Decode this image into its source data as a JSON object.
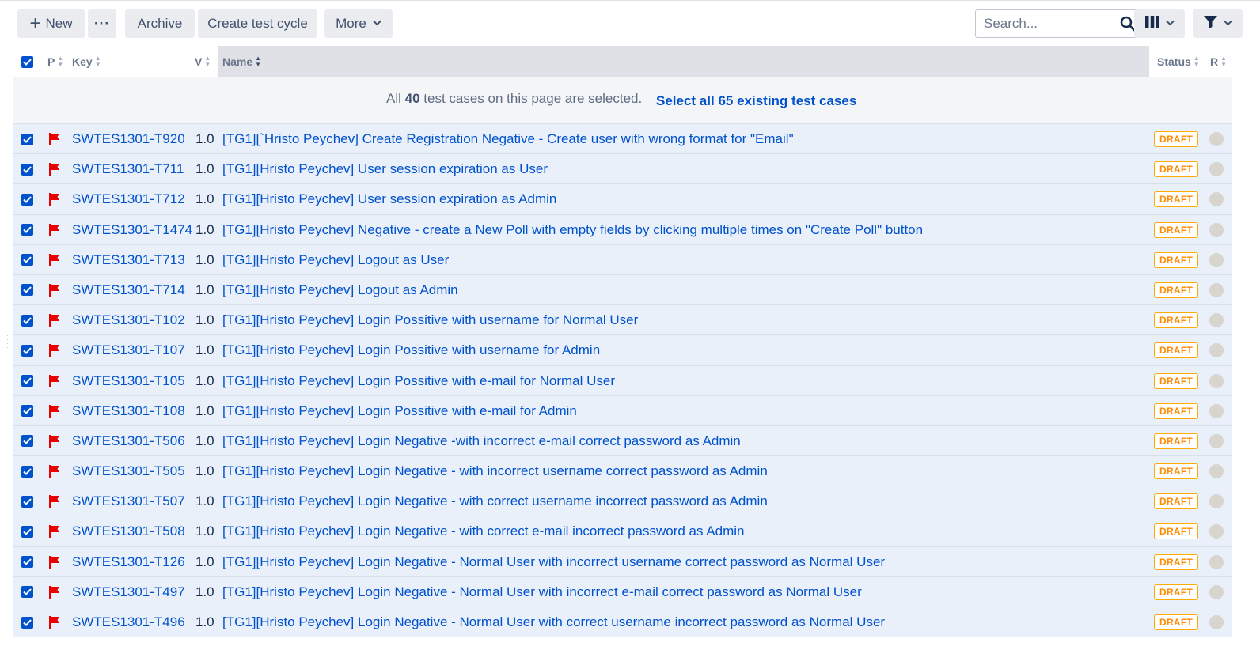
{
  "toolbar": {
    "new_label": "New",
    "more_dots_label": "···",
    "archive_label": "Archive",
    "create_cycle_label": "Create test cycle",
    "more_label": "More",
    "search_placeholder": "Search..."
  },
  "columns": {
    "priority": "P",
    "key": "Key",
    "version": "V",
    "name": "Name",
    "status": "Status",
    "result": "R"
  },
  "selection_banner": {
    "prefix": "All ",
    "count": "40",
    "suffix": " test cases on this page are selected.",
    "link_prefix": "Select all ",
    "link_count": "65",
    "link_suffix": " existing test cases"
  },
  "rows": [
    {
      "key": "SWTES1301-T920",
      "version": "1.0",
      "name": "[TG1][`Hristo Peychev] Create Registration Negative - Create user with wrong format for \"Email\"",
      "status": "DRAFT"
    },
    {
      "key": "SWTES1301-T711",
      "version": "1.0",
      "name": "[TG1][Hristo Peychev] User session expiration as User",
      "status": "DRAFT"
    },
    {
      "key": "SWTES1301-T712",
      "version": "1.0",
      "name": "[TG1][Hristo Peychev] User session expiration as Admin",
      "status": "DRAFT"
    },
    {
      "key": "SWTES1301-T1474",
      "version": "1.0",
      "name": "[TG1][Hristo Peychev] Negative - create a New Poll with empty fields by clicking multiple times on \"Create Poll\" button",
      "status": "DRAFT"
    },
    {
      "key": "SWTES1301-T713",
      "version": "1.0",
      "name": "[TG1][Hristo Peychev] Logout as User",
      "status": "DRAFT"
    },
    {
      "key": "SWTES1301-T714",
      "version": "1.0",
      "name": "[TG1][Hristo Peychev] Logout as Admin",
      "status": "DRAFT"
    },
    {
      "key": "SWTES1301-T102",
      "version": "1.0",
      "name": "[TG1][Hristo Peychev] Login Possitive with username for Normal User",
      "status": "DRAFT"
    },
    {
      "key": "SWTES1301-T107",
      "version": "1.0",
      "name": "[TG1][Hristo Peychev] Login Possitive with username for Admin",
      "status": "DRAFT"
    },
    {
      "key": "SWTES1301-T105",
      "version": "1.0",
      "name": "[TG1][Hristo Peychev] Login Possitive with e-mail for Normal User",
      "status": "DRAFT"
    },
    {
      "key": "SWTES1301-T108",
      "version": "1.0",
      "name": "[TG1][Hristo Peychev] Login Possitive with e-mail for Admin",
      "status": "DRAFT"
    },
    {
      "key": "SWTES1301-T506",
      "version": "1.0",
      "name": "[TG1][Hristo Peychev] Login Negative -with incorrect e-mail correct password as Admin",
      "status": "DRAFT"
    },
    {
      "key": "SWTES1301-T505",
      "version": "1.0",
      "name": "[TG1][Hristo Peychev] Login Negative - with incorrect username correct password as Admin",
      "status": "DRAFT"
    },
    {
      "key": "SWTES1301-T507",
      "version": "1.0",
      "name": "[TG1][Hristo Peychev] Login Negative - with correct username incorrect password as Admin",
      "status": "DRAFT"
    },
    {
      "key": "SWTES1301-T508",
      "version": "1.0",
      "name": "[TG1][Hristo Peychev] Login Negative - with correct e-mail incorrect password as Admin",
      "status": "DRAFT"
    },
    {
      "key": "SWTES1301-T126",
      "version": "1.0",
      "name": "[TG1][Hristo Peychev] Login Negative - Normal User with incorrect username correct password as Normal User",
      "status": "DRAFT"
    },
    {
      "key": "SWTES1301-T497",
      "version": "1.0",
      "name": "[TG1][Hristo Peychev] Login Negative - Normal User with incorrect e-mail correct password as Normal User",
      "status": "DRAFT"
    },
    {
      "key": "SWTES1301-T496",
      "version": "1.0",
      "name": "[TG1][Hristo Peychev] Login Negative - Normal User with correct username incorrect password as Normal User",
      "status": "DRAFT"
    }
  ],
  "colors": {
    "accent": "#0052cc",
    "priority_flag": "#e60000",
    "draft_border": "#ffab00",
    "draft_text": "#ff8b00",
    "row_selected_bg": "#e9f0fa"
  },
  "icons": {
    "new": "plus-icon",
    "search": "search-icon",
    "columns": "columns-icon",
    "filter": "filter-icon",
    "priority": "flag-icon"
  }
}
